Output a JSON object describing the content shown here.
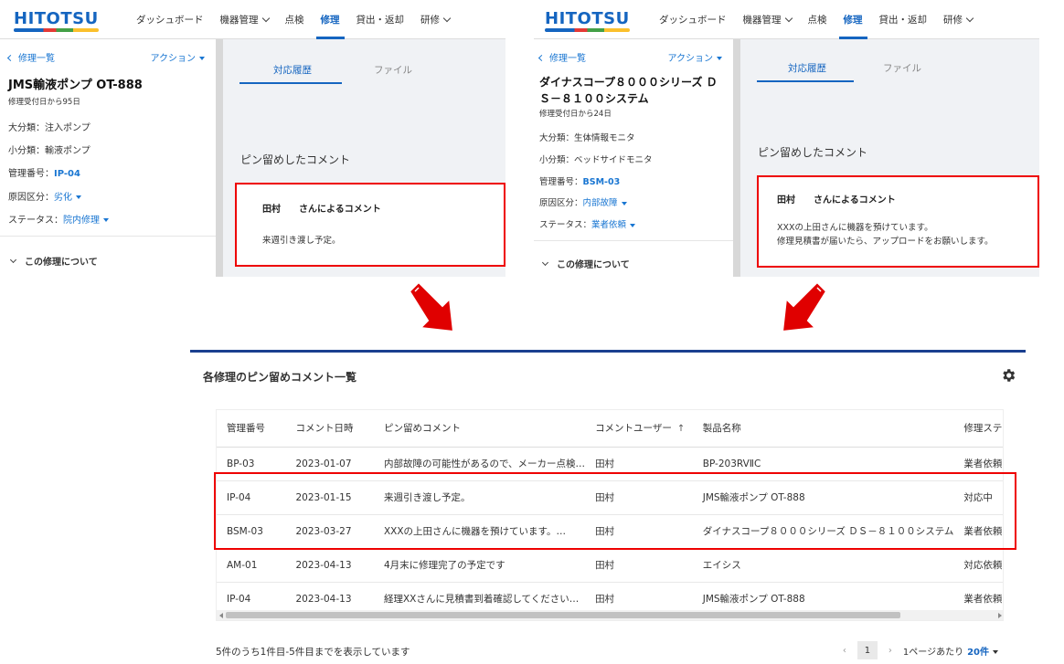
{
  "left_screen": {
    "logo": "HITOTSU",
    "nav": [
      "ダッシュボード",
      "機器管理",
      "点検",
      "修理",
      "貸出・返却",
      "研修"
    ],
    "active_nav": "修理",
    "back_label": "修理一覧",
    "action_label": "アクション",
    "title": "JMS輸液ポンプ OT-888",
    "subtitle": "修理受付日から95日",
    "fields": {
      "major_label": "大分類：注入ポンプ",
      "minor_label": "小分類：輸液ポンプ",
      "mgmt_label": "管理番号：",
      "mgmt_value": "IP-04",
      "cause_label": "原因区分：",
      "cause_value": "劣化",
      "status_label": "ステータス：",
      "status_value": "院内修理"
    },
    "section_label": "この修理について",
    "tabs": [
      "対応履歴",
      "ファイル"
    ],
    "pin_heading": "ピン留めしたコメント",
    "comment_author": "田村　　さんによるコメント",
    "comment_body": [
      "来週引き渡し予定。"
    ]
  },
  "right_screen": {
    "logo": "HITOTSU",
    "nav": [
      "ダッシュボード",
      "機器管理",
      "点検",
      "修理",
      "貸出・返却",
      "研修"
    ],
    "active_nav": "修理",
    "back_label": "修理一覧",
    "action_label": "アクション",
    "title_line1": "ダイナスコープ８０００シリーズ Ｄ",
    "title_line2": "Ｓ－８１００システム",
    "subtitle": "修理受付日から24日",
    "fields": {
      "major_label": "大分類：生体情報モニタ",
      "minor_label": "小分類：ベッドサイドモニタ",
      "mgmt_label": "管理番号：",
      "mgmt_value": "BSM-03",
      "cause_label": "原因区分：",
      "cause_value": "内部故障",
      "status_label": "ステータス：",
      "status_value": "業者依頼"
    },
    "section_label": "この修理について",
    "tabs": [
      "対応履歴",
      "ファイル"
    ],
    "pin_heading": "ピン留めしたコメント",
    "comment_author": "田村　　さんによるコメント",
    "comment_body": [
      "XXXの上田さんに機器を預けています。",
      "修理見積書が届いたら、アップロードをお願いします。"
    ]
  },
  "panel": {
    "title": "各修理のピン留めコメント一覧",
    "columns": [
      "管理番号",
      "コメント日時",
      "ピン留めコメント",
      "コメントユーザー",
      "製品名称",
      "修理ステータス"
    ],
    "sort_indicator": "↑",
    "rows": [
      [
        "BP-03",
        "2023-01-07",
        "内部故障の可能性があるので、メーカー点検…",
        "田村",
        "BP-203RVⅡC",
        "業者依頼"
      ],
      [
        "IP-04",
        "2023-01-15",
        "来週引き渡し予定。",
        "田村",
        "JMS輸液ポンプ OT-888",
        "対応中"
      ],
      [
        "BSM-03",
        "2023-03-27",
        "XXXの上田さんに機器を預けています。…",
        "田村",
        "ダイナスコープ８０００シリーズ ＤＳ－８１００システム",
        "業者依頼"
      ],
      [
        "AM-01",
        "2023-04-13",
        "4月末に修理完了の予定です",
        "田村",
        "エイシス",
        "対応依頼"
      ],
      [
        "IP-04",
        "2023-04-13",
        "経理XXさんに見積書到着確認してください…",
        "田村",
        "JMS輸液ポンプ OT-888",
        "業者依頼"
      ]
    ],
    "summary": "5件のうち1件目-5件目までを表示しています",
    "pagination": {
      "current_page": "1",
      "per_page_label": "1ページあたり",
      "per_page_value": "20件"
    }
  },
  "colors": {
    "brand_blue": "#1565c0",
    "highlight_red": "#e00000",
    "panel_top_border": "#1a3f8f"
  },
  "icons": [
    "gear-icon",
    "arrow-down-icon",
    "chevron-down-icon",
    "chevron-left-icon",
    "chevron-right-icon"
  ]
}
